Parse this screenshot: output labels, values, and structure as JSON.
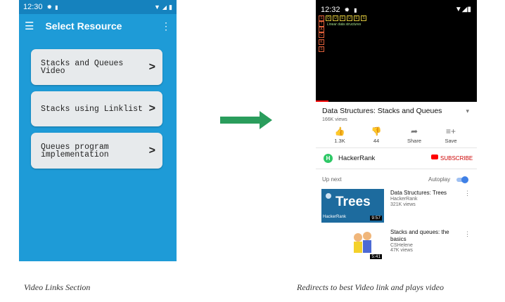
{
  "left_phone": {
    "status_time": "12:30",
    "title": "Select Resource",
    "items": [
      {
        "label": "Stacks and Queues Video"
      },
      {
        "label": "Stacks using Linklist"
      },
      {
        "label": "Queues program\nimplementation"
      }
    ],
    "chevron": ">",
    "caption": "Video Links Section"
  },
  "right_phone": {
    "status_time": "12:32",
    "video_overlay_text": "Linear data structures",
    "overlay_letters": [
      "S",
      "T",
      "A",
      "C",
      "K",
      "S"
    ],
    "top_row_letters": [
      "Q",
      "U",
      "E",
      "U",
      "E",
      "S"
    ],
    "video_title": "Data Structures: Stacks and Queues",
    "views": "166K views",
    "actions": [
      {
        "icon": "thumb-up-icon",
        "label": "1.3K"
      },
      {
        "icon": "thumb-down-icon",
        "label": "44"
      },
      {
        "icon": "share-icon",
        "label": "Share"
      },
      {
        "icon": "save-icon",
        "label": "Save"
      }
    ],
    "channel_name": "HackerRank",
    "subscribe_label": "SUBSCRIBE",
    "up_next_label": "Up next",
    "autoplay_label": "Autoplay",
    "suggestions": [
      {
        "title": "Data Structures: Trees",
        "channel": "HackerRank",
        "views": "321K views",
        "duration": "9:57",
        "thumb_text": "Trees",
        "thumb_brand": "HackerRank"
      },
      {
        "title": "Stacks and queues: the basics",
        "channel": "CSHelene",
        "views": "47K views",
        "duration": "5:41"
      }
    ],
    "caption": "Redirects to best Video link and plays video"
  },
  "colors": {
    "left_bg": "#1e9bd7",
    "arrow": "#2a9d5c",
    "youtube_red": "#ff0000",
    "toggle_blue": "#3f80e6"
  }
}
